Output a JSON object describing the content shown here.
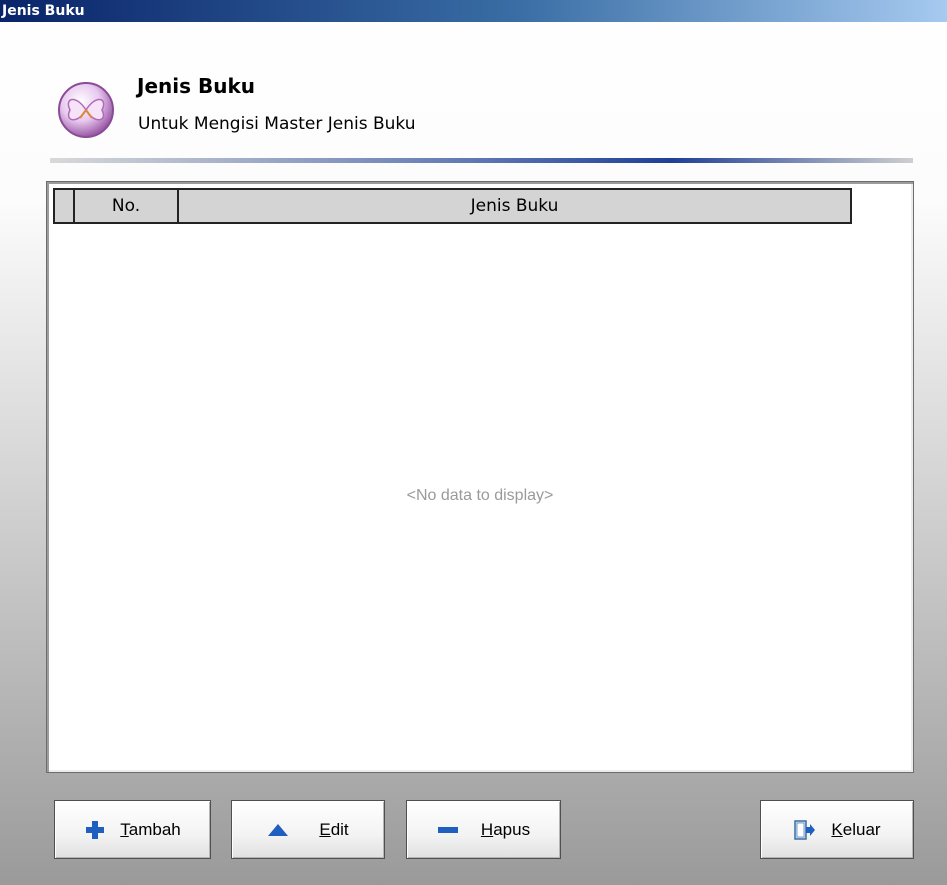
{
  "window": {
    "title": "Jenis Buku"
  },
  "header": {
    "title": "Jenis Buku",
    "subtitle": "Untuk Mengisi Master Jenis Buku",
    "icon": "butterfly-icon"
  },
  "grid": {
    "columns": [
      "No.",
      "Jenis Buku"
    ],
    "rows": [],
    "empty_text": "<No data to display>"
  },
  "buttons": {
    "tambah": {
      "label": "Tambah",
      "icon": "plus-icon"
    },
    "edit": {
      "label": "Edit",
      "icon": "triangle-up-icon"
    },
    "hapus": {
      "label": "Hapus",
      "icon": "minus-icon"
    },
    "keluar": {
      "label": "Keluar",
      "icon": "exit-door-icon"
    }
  },
  "colors": {
    "accent": "#0a246a",
    "icon_blue": "#1f5fbf"
  }
}
